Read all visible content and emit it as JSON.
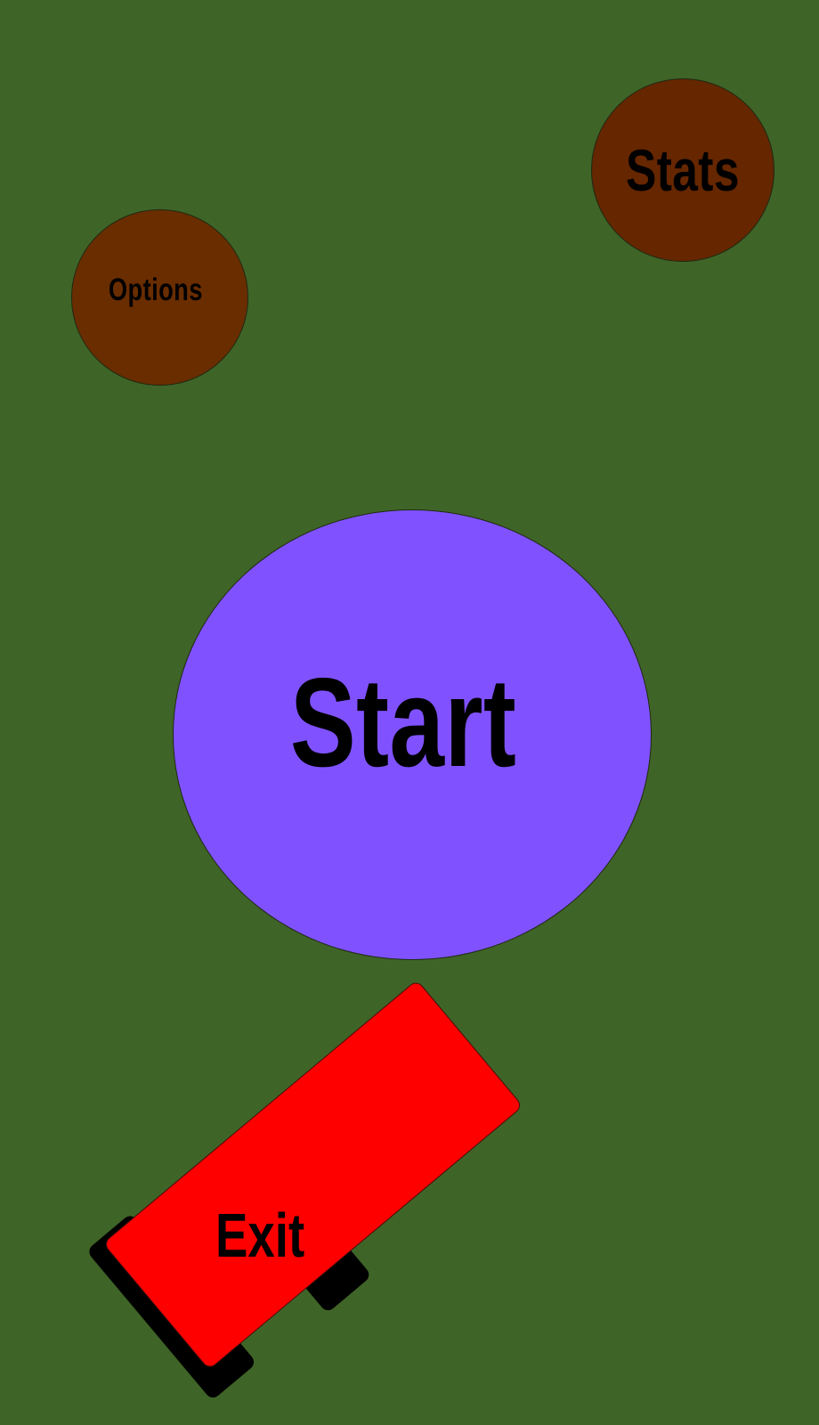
{
  "menu": {
    "stats_label": "Stats",
    "options_label": "Options",
    "start_label": "Start",
    "exit_label": "Exit"
  },
  "colors": {
    "background": "#3f6427",
    "stats_fill": "#652600",
    "options_fill": "#6a2d00",
    "start_fill": "#8052ff",
    "exit_fill": "#ff0000",
    "wheel_fill": "#000000"
  }
}
